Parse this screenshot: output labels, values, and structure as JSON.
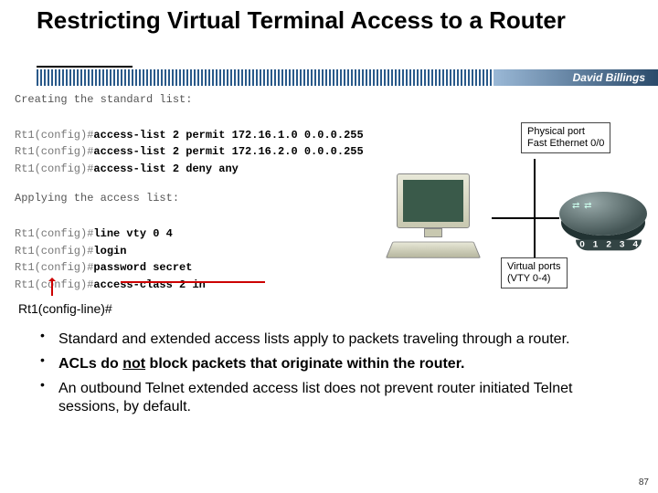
{
  "title": "Restricting Virtual Terminal Access to a Router",
  "author": "David Billings",
  "code": {
    "header1": "Creating the standard list:",
    "line1_prompt": "Rt1(config)#",
    "line1_cmd": "access-list 2 permit 172.16.1.0 0.0.0.255",
    "line2_prompt": "Rt1(config)#",
    "line2_cmd": "access-list 2 permit 172.16.2.0 0.0.0.255",
    "line3_prompt": "Rt1(config)#",
    "line3_cmd": "access-list 2 deny any",
    "header2": "Applying the access list:",
    "line4_prompt": "Rt1(config)#",
    "line4_cmd": "line vty 0 4",
    "line5_prompt": "Rt1(config)#",
    "line5_cmd": "login",
    "line6_prompt": "Rt1(config)#",
    "line6_cmd": "password secret",
    "line7_prompt": "Rt1(config)#",
    "line7_cmd": "access-class 2 in"
  },
  "prompt_label": "Rt1(config-line)#",
  "diagram": {
    "phys_label_l1": "Physical port",
    "phys_label_l2": "Fast Ethernet 0/0",
    "virt_label_l1": "Virtual ports",
    "virt_label_l2": "(VTY 0-4)",
    "ports": [
      "0",
      "1",
      "2",
      "3",
      "4"
    ]
  },
  "bullets": {
    "b1": "Standard and extended access lists apply to packets traveling through a router.",
    "b2_pre": "ACLs do ",
    "b2_u": "not",
    "b2_post": " block packets that originate within the router.",
    "b3": "An outbound Telnet extended access list does not prevent router initiated Telnet sessions, by default."
  },
  "page_number": "87"
}
